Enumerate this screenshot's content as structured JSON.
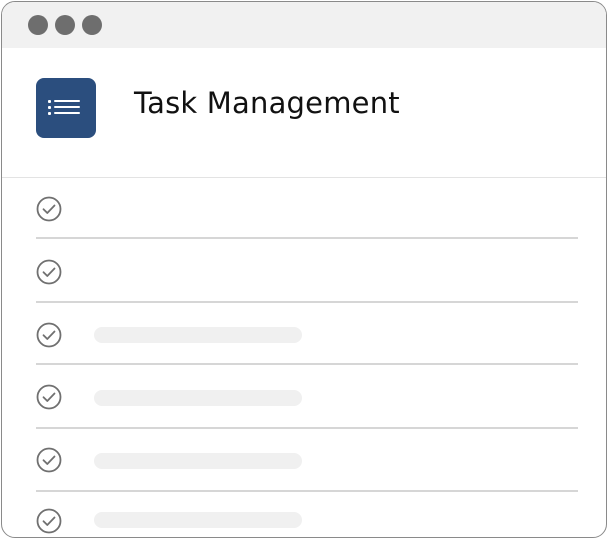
{
  "window": {
    "controls": [
      "close",
      "minimize",
      "maximize"
    ]
  },
  "header": {
    "title": "Task Management",
    "icon": "list-icon",
    "icon_color": "#2b4e7e"
  },
  "tasks": [
    {
      "status": "complete",
      "text": ""
    },
    {
      "status": "complete",
      "text": ""
    },
    {
      "status": "complete",
      "text": ""
    },
    {
      "status": "complete",
      "text": ""
    },
    {
      "status": "complete",
      "text": ""
    },
    {
      "status": "complete",
      "text": ""
    }
  ],
  "colors": {
    "titlebar": "#f1f1f1",
    "window_dot": "#6e6e6e",
    "check": "#707070",
    "placeholder": "#f0f0f0",
    "divider": "#d6d6d6"
  }
}
